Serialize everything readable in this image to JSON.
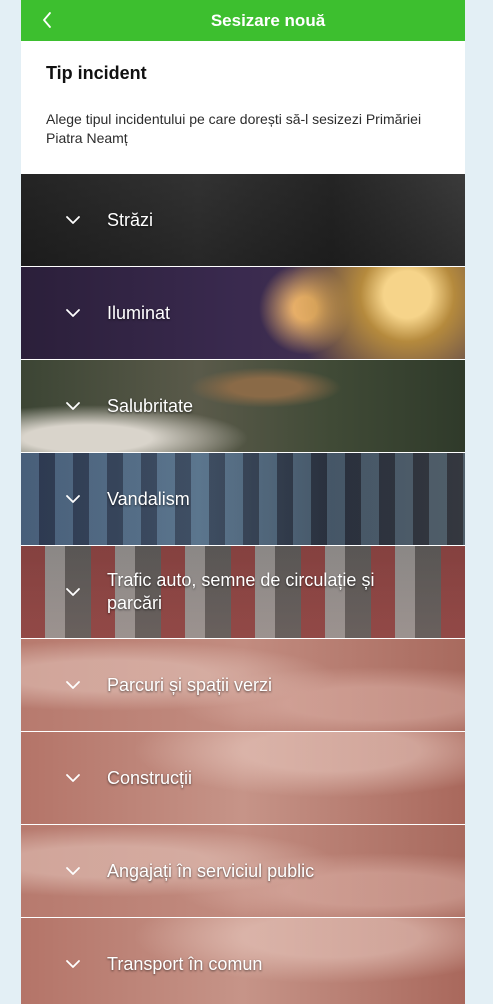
{
  "topbar": {
    "title": "Sesizare nouă",
    "color": "#3dbf2f",
    "back_icon": "chevron-left-icon"
  },
  "header": {
    "title": "Tip incident",
    "description": "Alege tipul incidentului pe care dorești să-l sesizezi Primăriei Piatra Neamț"
  },
  "categories": [
    {
      "label": "Străzi",
      "icon": "chevron-down-icon"
    },
    {
      "label": "Iluminat",
      "icon": "chevron-down-icon"
    },
    {
      "label": "Salubritate",
      "icon": "chevron-down-icon"
    },
    {
      "label": "Vandalism",
      "icon": "chevron-down-icon"
    },
    {
      "label": "Trafic auto, semne de circulație și parcări",
      "icon": "chevron-down-icon"
    },
    {
      "label": "Parcuri și spații verzi",
      "icon": "chevron-down-icon"
    },
    {
      "label": "Construcții",
      "icon": "chevron-down-icon"
    },
    {
      "label": "Angajați în serviciul public",
      "icon": "chevron-down-icon"
    },
    {
      "label": "Transport în comun",
      "icon": "chevron-down-icon"
    }
  ]
}
